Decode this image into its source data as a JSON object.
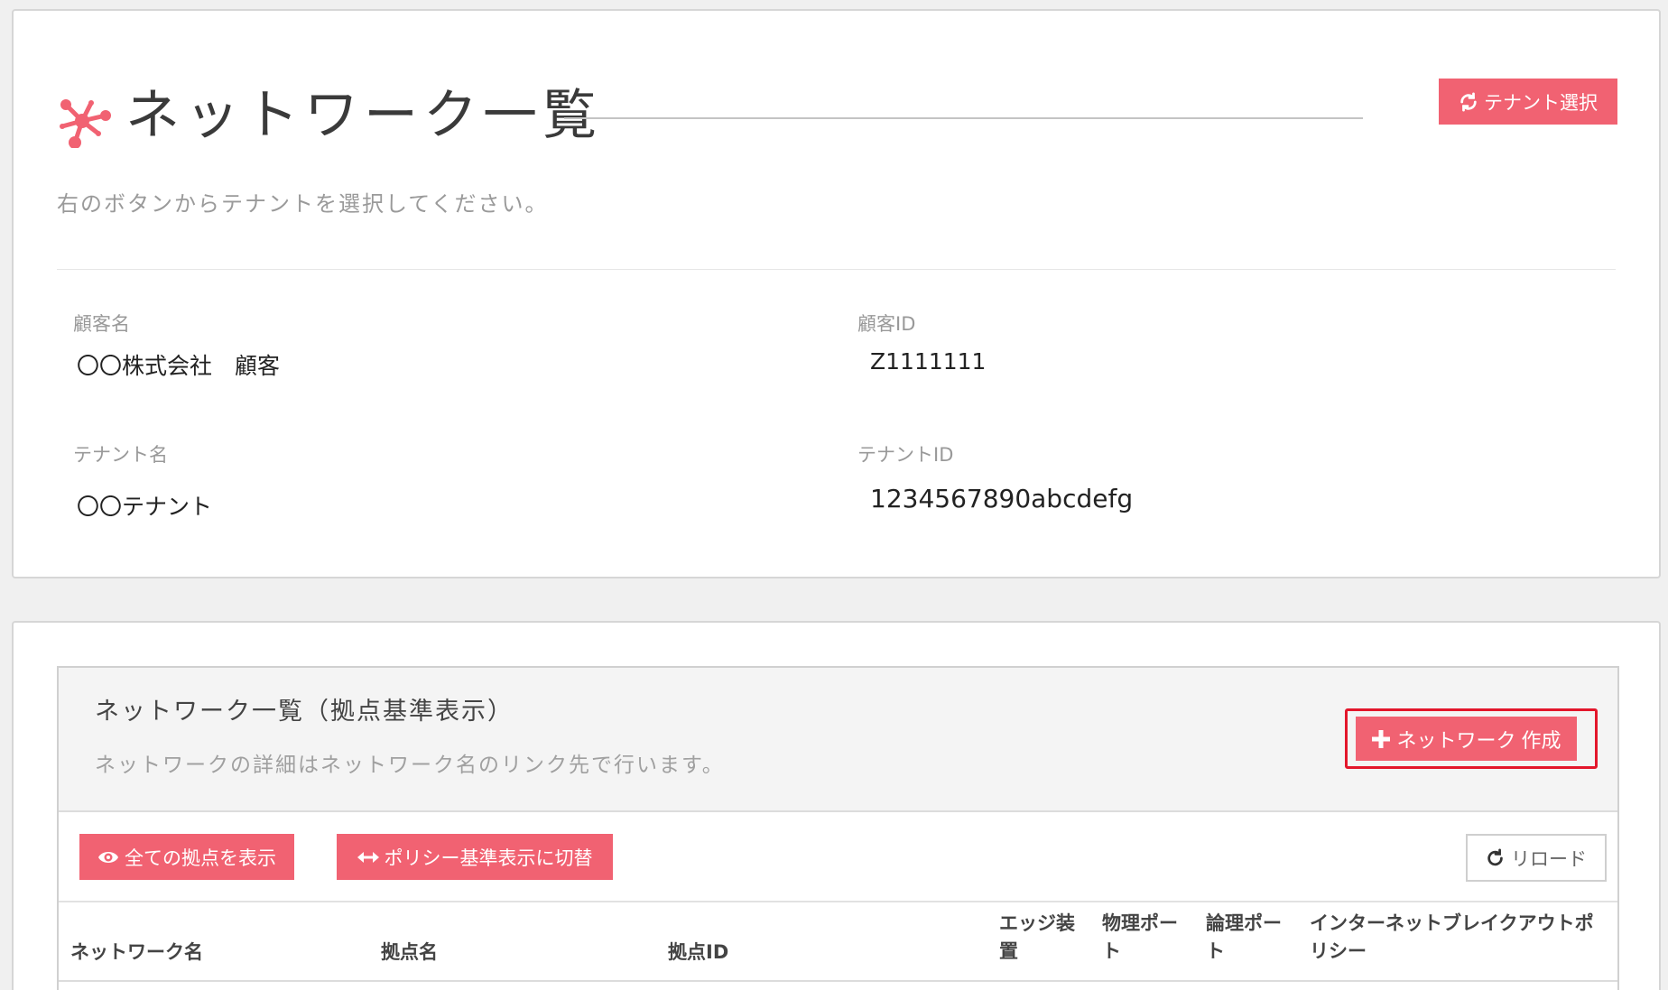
{
  "header": {
    "title": "ネットワーク一覧",
    "logo_icon": "network-nodes-icon",
    "tenant_button_label": "テナント選択",
    "tenant_button_icon": "refresh-icon",
    "subtitle": "右のボタンからテナントを選択してください。"
  },
  "tenant_info": {
    "customer_name_label": "顧客名",
    "customer_name_value": "〇〇株式会社　顧客",
    "customer_id_label": "顧客ID",
    "customer_id_value": "Z1111111",
    "tenant_name_label": "テナント名",
    "tenant_name_value": "〇〇テナント",
    "tenant_id_label": "テナントID",
    "tenant_id_value": "1234567890abcdefg"
  },
  "network_panel": {
    "title": "ネットワーク一覧（拠点基準表示）",
    "subtitle": "ネットワークの詳細はネットワーク名のリンク先で行います。",
    "create_button_label": "ネットワーク 作成",
    "create_button_icon": "plus-icon",
    "show_all_label": "全ての拠点を表示",
    "show_all_icon": "eye-icon",
    "switch_policy_label": "ポリシー基準表示に切替",
    "switch_policy_icon": "arrows-horizontal-icon",
    "reload_label": "リロード",
    "reload_icon": "reload-icon"
  },
  "table": {
    "columns": [
      {
        "line1": "ネットワーク名",
        "line2": ""
      },
      {
        "line1": "拠点名",
        "line2": ""
      },
      {
        "line1": "拠点ID",
        "line2": ""
      },
      {
        "line1": "エッジ装",
        "line2": "置"
      },
      {
        "line1": "物理ポー",
        "line2": "ト"
      },
      {
        "line1": "論理ポー",
        "line2": "ト"
      },
      {
        "line1": "インターネットブレイクアウトポ",
        "line2": "リシー"
      }
    ]
  },
  "colors": {
    "accent": "#f16272",
    "highlight_border": "#e3162b",
    "page_background": "#f0f0f0"
  }
}
